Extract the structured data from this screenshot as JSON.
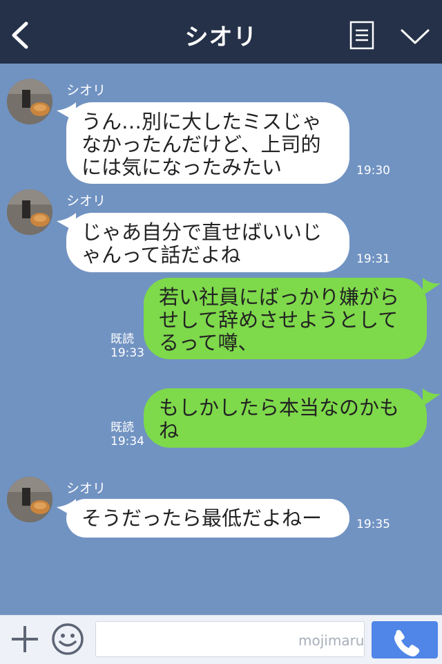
{
  "header": {
    "title": "シオリ"
  },
  "messages": [
    {
      "sender": "シオリ",
      "text": "うん…別に大したミスじゃ\nなかったんだけど、上司的\nには気になったみたい",
      "time": "19:30"
    },
    {
      "sender": "シオリ",
      "text": "じゃあ自分で直せばいいじ\nゃんって話だよね",
      "time": "19:31"
    },
    {
      "text": "若い社員にばっかり嫌がら\nせして辞めさせようとして\nるって噂、",
      "status": "既読",
      "time": "19:33"
    },
    {
      "text": "もしかしたら本当なのかも\nね",
      "status": "既読",
      "time": "19:34"
    },
    {
      "sender": "シオリ",
      "text": "そうだったら最低だよねー",
      "time": "19:35"
    }
  ],
  "input": {
    "placeholder": "",
    "watermark": "mojimaru"
  },
  "colors": {
    "header": "#253148",
    "background": "#7193c2",
    "incoming": "#ffffff",
    "outgoing": "#7ed94b",
    "send": "#4f86e8"
  },
  "icons": {
    "back": "chevron-left-icon",
    "menu": "note-icon",
    "collapse": "chevron-down-icon",
    "add": "plus-icon",
    "emoji": "smiley-icon",
    "call": "phone-icon"
  }
}
